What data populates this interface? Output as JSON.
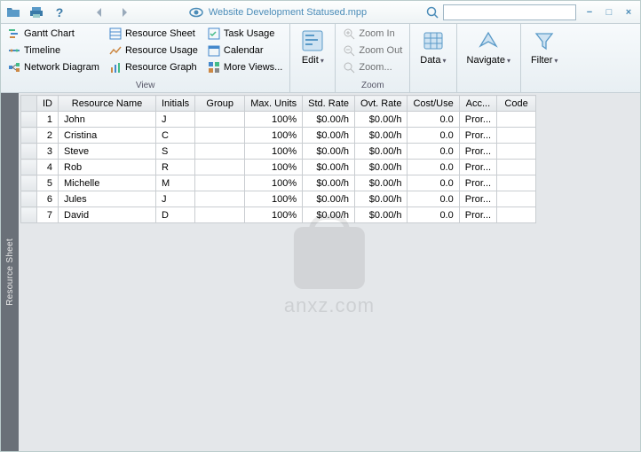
{
  "title": "Website Development Statused.mpp",
  "search_placeholder": "",
  "ribbon": {
    "view_group_label": "View",
    "zoom_group_label": "Zoom",
    "view_buttons": {
      "gantt": "Gantt Chart",
      "timeline": "Timeline",
      "network": "Network Diagram",
      "res_sheet": "Resource Sheet",
      "res_usage": "Resource Usage",
      "res_graph": "Resource Graph",
      "task_usage": "Task Usage",
      "calendar": "Calendar",
      "more": "More Views..."
    },
    "edit_label": "Edit",
    "zoom_in": "Zoom In",
    "zoom_out": "Zoom Out",
    "zoom": "Zoom...",
    "data_label": "Data",
    "navigate_label": "Navigate",
    "filter_label": "Filter"
  },
  "sidebar_label": "Resource Sheet",
  "table": {
    "headers": [
      "ID",
      "Resource Name",
      "Initials",
      "Group",
      "Max. Units",
      "Std. Rate",
      "Ovt. Rate",
      "Cost/Use",
      "Acc...",
      "Code"
    ],
    "rows": [
      {
        "id": "1",
        "name": "John",
        "initials": "J",
        "group": "",
        "max": "100%",
        "std": "$0.00/h",
        "ovt": "$0.00/h",
        "cost": "0.0",
        "acc": "Pror...",
        "code": ""
      },
      {
        "id": "2",
        "name": "Cristina",
        "initials": "C",
        "group": "",
        "max": "100%",
        "std": "$0.00/h",
        "ovt": "$0.00/h",
        "cost": "0.0",
        "acc": "Pror...",
        "code": ""
      },
      {
        "id": "3",
        "name": "Steve",
        "initials": "S",
        "group": "",
        "max": "100%",
        "std": "$0.00/h",
        "ovt": "$0.00/h",
        "cost": "0.0",
        "acc": "Pror...",
        "code": ""
      },
      {
        "id": "4",
        "name": "Rob",
        "initials": "R",
        "group": "",
        "max": "100%",
        "std": "$0.00/h",
        "ovt": "$0.00/h",
        "cost": "0.0",
        "acc": "Pror...",
        "code": ""
      },
      {
        "id": "5",
        "name": "Michelle",
        "initials": "M",
        "group": "",
        "max": "100%",
        "std": "$0.00/h",
        "ovt": "$0.00/h",
        "cost": "0.0",
        "acc": "Pror...",
        "code": ""
      },
      {
        "id": "6",
        "name": "Jules",
        "initials": "J",
        "group": "",
        "max": "100%",
        "std": "$0.00/h",
        "ovt": "$0.00/h",
        "cost": "0.0",
        "acc": "Pror...",
        "code": ""
      },
      {
        "id": "7",
        "name": "David",
        "initials": "D",
        "group": "",
        "max": "100%",
        "std": "$0.00/h",
        "ovt": "$0.00/h",
        "cost": "0.0",
        "acc": "Pror...",
        "code": ""
      }
    ]
  },
  "watermark": "anxz.com",
  "col_widths": {
    "corner": 14,
    "id": 22,
    "name": 110,
    "initials": 40,
    "group": 56,
    "max": 56,
    "std": 50,
    "ovt": 50,
    "cost": 52,
    "acc": 36,
    "code": 44
  }
}
